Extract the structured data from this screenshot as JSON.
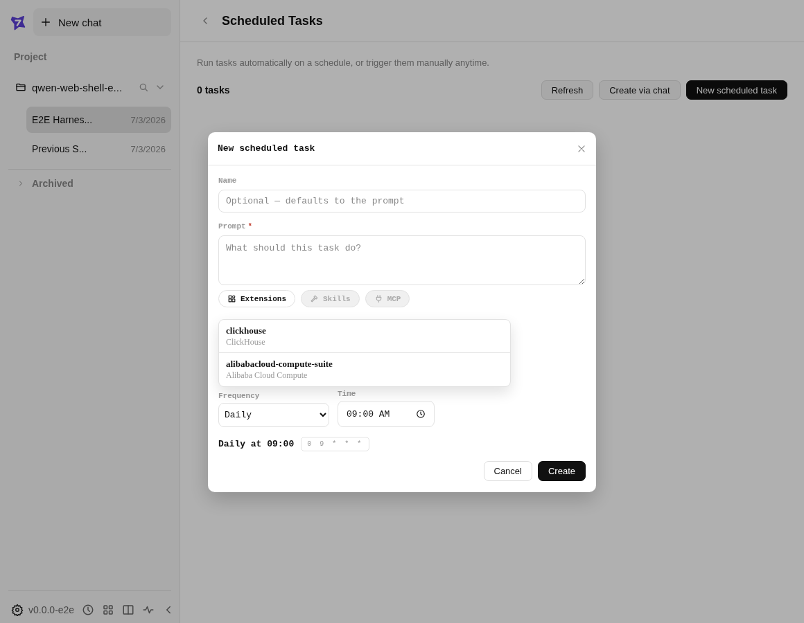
{
  "sidebar": {
    "new_chat": "New chat",
    "section_label": "Project",
    "project": {
      "name": "qwen-web-shell-e...",
      "expanded": true
    },
    "sessions": [
      {
        "title": "E2E Harnes...",
        "date": "7/3/2026",
        "selected": true
      },
      {
        "title": "Previous S...",
        "date": "7/3/2026",
        "selected": false
      }
    ],
    "archived": {
      "label": "Archived",
      "expanded": false
    },
    "version": "v0.0.0-e2e"
  },
  "main": {
    "title": "Scheduled Tasks",
    "description": "Run tasks automatically on a schedule, or trigger them manually anytime.",
    "count": "0 tasks",
    "actions": [
      {
        "label": "Refresh",
        "kind": "secondary"
      },
      {
        "label": "Create via chat",
        "kind": "secondary"
      },
      {
        "label": "New scheduled task",
        "kind": "primary"
      }
    ]
  },
  "dialog": {
    "title": "New scheduled task",
    "name_field": {
      "label": "Name",
      "placeholder": "Optional — defaults to the prompt"
    },
    "prompt_field": {
      "label": "Prompt",
      "required_mark": "*",
      "placeholder": "What should this task do?"
    },
    "chips": [
      {
        "label": "Extensions",
        "kind": "extensions",
        "disabled": false
      },
      {
        "label": "Skills",
        "kind": "skills",
        "disabled": true
      },
      {
        "label": "MCP",
        "kind": "mcp",
        "disabled": true
      }
    ],
    "dropdown": [
      {
        "name": "clickhouse",
        "description": "ClickHouse"
      },
      {
        "name": "alibabacloud-compute-suite",
        "description": "Alibaba Cloud Compute"
      }
    ],
    "frequency": {
      "label": "Frequency",
      "value": "Daily"
    },
    "time": {
      "label": "Time",
      "value": "09:00 AM"
    },
    "summary": "Daily at 09:00",
    "cron": "0 9 * * *",
    "buttons": [
      {
        "label": "Cancel",
        "kind": "secondary"
      },
      {
        "label": "Create",
        "kind": "primary"
      }
    ]
  }
}
